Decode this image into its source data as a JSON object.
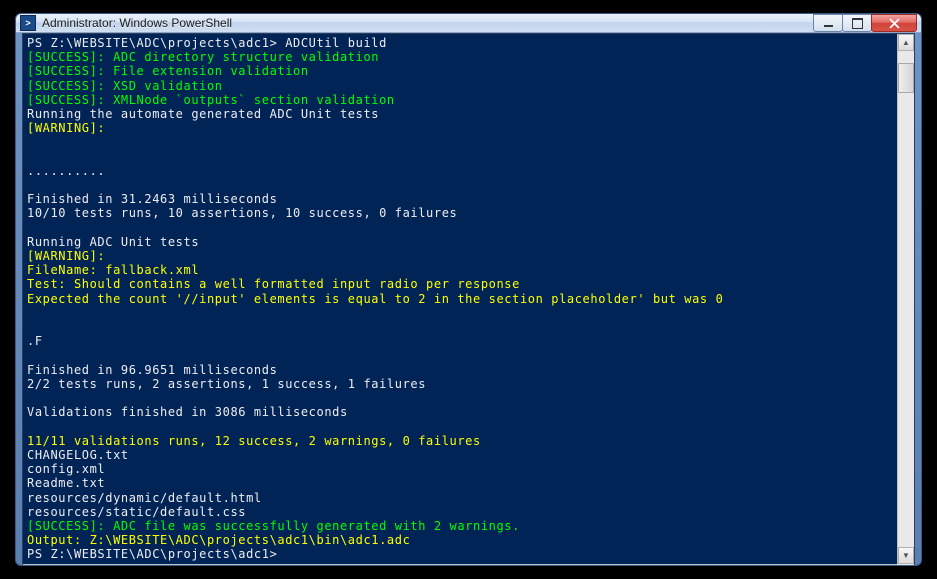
{
  "window": {
    "title": "Administrator: Windows PowerShell",
    "icon_label": ">"
  },
  "colors": {
    "bg": "#012456",
    "fg": "#eeedf0",
    "success": "#00ff00",
    "warning": "#ffff00"
  },
  "lines": [
    {
      "segments": [
        {
          "text": "PS Z:\\WEBSITE\\ADC\\projects\\adc1> ADCUtil build",
          "cls": "white"
        }
      ]
    },
    {
      "segments": [
        {
          "text": "[SUCCESS]: ADC directory structure validation",
          "cls": "green"
        }
      ]
    },
    {
      "segments": [
        {
          "text": "[SUCCESS]: File extension validation",
          "cls": "green"
        }
      ]
    },
    {
      "segments": [
        {
          "text": "[SUCCESS]: XSD validation",
          "cls": "green"
        }
      ]
    },
    {
      "segments": [
        {
          "text": "[SUCCESS]: XMLNode `outputs` section validation",
          "cls": "green"
        }
      ]
    },
    {
      "segments": [
        {
          "text": "Running the automate generated ADC Unit tests",
          "cls": "white"
        }
      ]
    },
    {
      "segments": [
        {
          "text": "[WARNING]:",
          "cls": "yellow"
        }
      ]
    },
    {
      "segments": [
        {
          "text": "",
          "cls": "white"
        }
      ]
    },
    {
      "segments": [
        {
          "text": "",
          "cls": "white"
        }
      ]
    },
    {
      "segments": [
        {
          "text": "..........",
          "cls": "white"
        }
      ]
    },
    {
      "segments": [
        {
          "text": "",
          "cls": "white"
        }
      ]
    },
    {
      "segments": [
        {
          "text": "Finished in 31.2463 milliseconds",
          "cls": "white"
        }
      ]
    },
    {
      "segments": [
        {
          "text": "10/10 tests runs, 10 assertions, 10 success, 0 failures",
          "cls": "white"
        }
      ]
    },
    {
      "segments": [
        {
          "text": "",
          "cls": "white"
        }
      ]
    },
    {
      "segments": [
        {
          "text": "Running ADC Unit tests",
          "cls": "white"
        }
      ]
    },
    {
      "segments": [
        {
          "text": "[WARNING]:",
          "cls": "yellow"
        }
      ]
    },
    {
      "segments": [
        {
          "text": "FileName: fallback.xml",
          "cls": "yellow"
        }
      ]
    },
    {
      "segments": [
        {
          "text": "Test: Should contains a well formatted input radio per response",
          "cls": "yellow"
        }
      ]
    },
    {
      "segments": [
        {
          "text": "Expected the count '//input' elements is equal to 2 in the section placeholder' but was 0",
          "cls": "yellow"
        }
      ]
    },
    {
      "segments": [
        {
          "text": "",
          "cls": "white"
        }
      ]
    },
    {
      "segments": [
        {
          "text": "",
          "cls": "white"
        }
      ]
    },
    {
      "segments": [
        {
          "text": ".F",
          "cls": "white"
        }
      ]
    },
    {
      "segments": [
        {
          "text": "",
          "cls": "white"
        }
      ]
    },
    {
      "segments": [
        {
          "text": "Finished in 96.9651 milliseconds",
          "cls": "white"
        }
      ]
    },
    {
      "segments": [
        {
          "text": "2/2 tests runs, 2 assertions, 1 success, 1 failures",
          "cls": "white"
        }
      ]
    },
    {
      "segments": [
        {
          "text": "",
          "cls": "white"
        }
      ]
    },
    {
      "segments": [
        {
          "text": "Validations finished in 3086 milliseconds",
          "cls": "white"
        }
      ]
    },
    {
      "segments": [
        {
          "text": "",
          "cls": "white"
        }
      ]
    },
    {
      "segments": [
        {
          "text": "11/11 validations runs, 12 success, 2 warnings, 0 failures",
          "cls": "yellow"
        }
      ]
    },
    {
      "segments": [
        {
          "text": "CHANGELOG.txt",
          "cls": "white"
        }
      ]
    },
    {
      "segments": [
        {
          "text": "config.xml",
          "cls": "white"
        }
      ]
    },
    {
      "segments": [
        {
          "text": "Readme.txt",
          "cls": "white"
        }
      ]
    },
    {
      "segments": [
        {
          "text": "resources/dynamic/default.html",
          "cls": "white"
        }
      ]
    },
    {
      "segments": [
        {
          "text": "resources/static/default.css",
          "cls": "white"
        }
      ]
    },
    {
      "segments": [
        {
          "text": "[SUCCESS]: ADC file was successfully generated with 2 warnings.",
          "cls": "green"
        }
      ]
    },
    {
      "segments": [
        {
          "text": "Output: Z:\\WEBSITE\\ADC\\projects\\adc1\\bin\\adc1.adc",
          "cls": "yellow"
        }
      ]
    },
    {
      "segments": [
        {
          "text": "PS Z:\\WEBSITE\\ADC\\projects\\adc1>",
          "cls": "white"
        }
      ]
    }
  ]
}
